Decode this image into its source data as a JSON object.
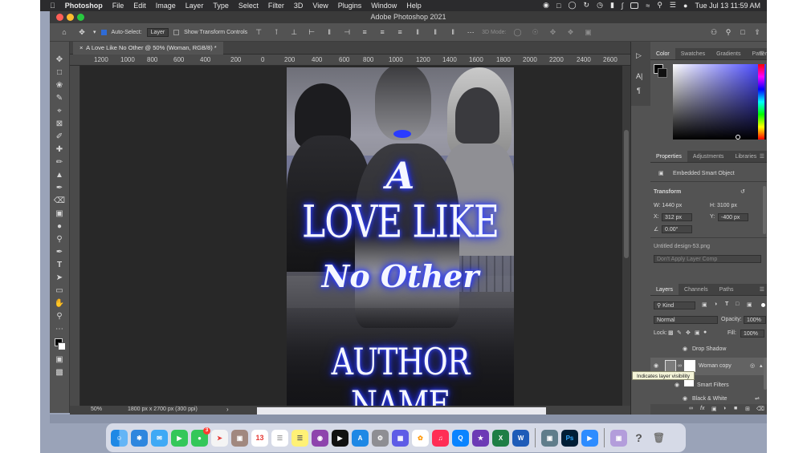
{
  "menubar": {
    "app_name": "Photoshop",
    "menus": [
      "File",
      "Edit",
      "Image",
      "Layer",
      "Type",
      "Select",
      "Filter",
      "3D",
      "View",
      "Plugins",
      "Window",
      "Help"
    ],
    "clock": "Tue Jul 13  11:59 AM"
  },
  "window": {
    "title": "Adobe Photoshop 2021"
  },
  "options_bar": {
    "auto_select_label": "Auto-Select:",
    "auto_select_value": "Layer",
    "transform_controls_label": "Show Transform Controls",
    "mode_3d_label": "3D Mode:"
  },
  "document": {
    "tab_title": "A Love Like No Other @ 50% (Woman, RGB/8) *",
    "ruler_labels": [
      "1200",
      "1000",
      "800",
      "600",
      "400",
      "200",
      "0",
      "200",
      "400",
      "600",
      "800",
      "1000",
      "1200",
      "1400",
      "1600",
      "1800",
      "2000",
      "2200",
      "2400",
      "2600"
    ],
    "zoom": "50%",
    "doc_info": "1800 px x 2700 px (300 ppi)"
  },
  "cover": {
    "title_line1": "A",
    "title_line2": "LOVE LIKE",
    "title_line3": "No Other",
    "author": "AUTHOR NAME",
    "glow_color": "#2433ff"
  },
  "color_panel": {
    "tabs": [
      "Color",
      "Swatches",
      "Gradients",
      "Patterns"
    ]
  },
  "properties_panel": {
    "tabs": [
      "Properties",
      "Adjustments",
      "Libraries"
    ],
    "object_type": "Embedded Smart Object",
    "transform_label": "Transform",
    "w": "W: 1440 px",
    "h": "H: 3100 px",
    "x_label": "X:",
    "x_value": "312 px",
    "y_label": "Y:",
    "y_value": "-400 px",
    "angle": "0.00°",
    "file_name": "Untitled design-53.png",
    "layer_comp": "Don't Apply Layer Comp"
  },
  "layers_panel": {
    "tabs": [
      "Layers",
      "Channels",
      "Paths"
    ],
    "filter_kind": "Kind",
    "blend_mode": "Normal",
    "opacity_label": "Opacity:",
    "opacity_value": "100%",
    "lock_label": "Lock:",
    "fill_label": "Fill:",
    "fill_value": "100%",
    "rows": [
      {
        "name": "Drop Shadow"
      },
      {
        "name": "Woman copy"
      },
      {
        "name": "Smart Filters"
      },
      {
        "name": "Black & White"
      }
    ],
    "tooltip": "Indicates layer visibility"
  },
  "dock": {
    "calendar_day": "13",
    "messages_badge": "3"
  }
}
